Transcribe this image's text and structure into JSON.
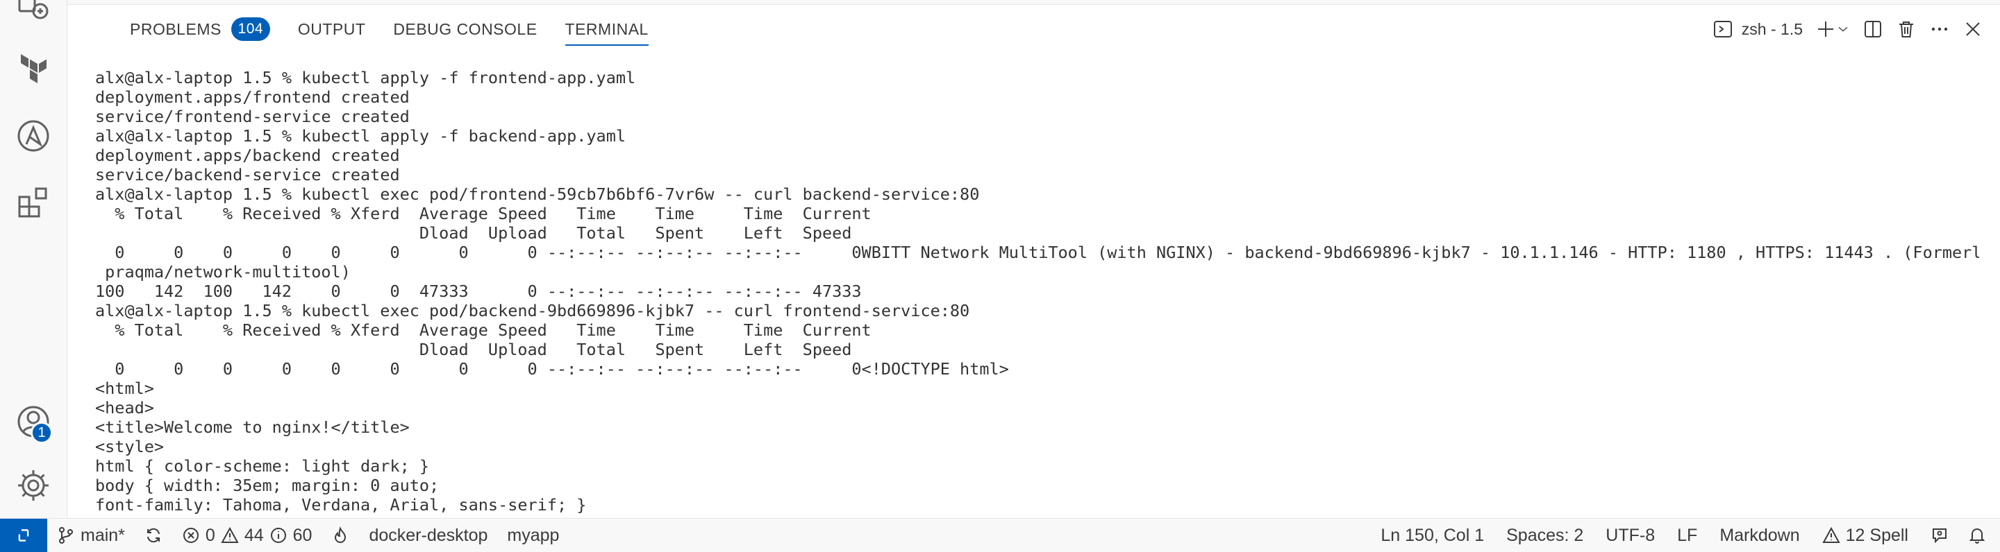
{
  "panel": {
    "tabs": [
      {
        "label": "PROBLEMS",
        "badge": "104"
      },
      {
        "label": "OUTPUT"
      },
      {
        "label": "DEBUG CONSOLE"
      },
      {
        "label": "TERMINAL",
        "active": true
      }
    ],
    "terminal_name": "zsh - 1.5"
  },
  "terminal": {
    "lines": [
      "alx@alx-laptop 1.5 % kubectl apply -f frontend-app.yaml",
      "deployment.apps/frontend created",
      "service/frontend-service created",
      "alx@alx-laptop 1.5 % kubectl apply -f backend-app.yaml",
      "deployment.apps/backend created",
      "service/backend-service created",
      "alx@alx-laptop 1.5 % kubectl exec pod/frontend-59cb7b6bf6-7vr6w -- curl backend-service:80",
      "  % Total    % Received % Xferd  Average Speed   Time    Time     Time  Current",
      "                                 Dload  Upload   Total   Spent    Left  Speed",
      "  0     0    0     0    0     0      0      0 --:--:-- --:--:-- --:--:--     0WBITT Network MultiTool (with NGINX) - backend-9bd669896-kjbk7 - 10.1.1.146 - HTTP: 1180 , HTTPS: 11443 . (Formerly",
      " praqma/network-multitool)",
      "100   142  100   142    0     0  47333      0 --:--:-- --:--:-- --:--:-- 47333",
      "alx@alx-laptop 1.5 % kubectl exec pod/backend-9bd669896-kjbk7 -- curl frontend-service:80",
      "  % Total    % Received % Xferd  Average Speed   Time    Time     Time  Current",
      "                                 Dload  Upload   Total   Spent    Left  Speed",
      "  0     0    0     0    0     0      0      0 --:--:-- --:--:-- --:--:--     0<!DOCTYPE html>",
      "<html>",
      "<head>",
      "<title>Welcome to nginx!</title>",
      "<style>",
      "html { color-scheme: light dark; }",
      "body { width: 35em; margin: 0 auto;",
      "font-family: Tahoma, Verdana, Arial, sans-serif; }"
    ]
  },
  "activity_bar": {
    "account_badge": "1",
    "icons": [
      "remote-explorer-icon",
      "terraform-icon",
      "ansible-icon",
      "extensions-icon",
      "accounts-icon",
      "manage-gear-icon"
    ]
  },
  "statusbar": {
    "branch": "main*",
    "errors": "0",
    "warnings": "44",
    "infos": "60",
    "context": "docker-desktop",
    "namespace": "myapp",
    "position": "Ln 150, Col 1",
    "spaces": "Spaces: 2",
    "encoding": "UTF-8",
    "eol": "LF",
    "language": "Markdown",
    "spell": "12 Spell"
  },
  "colors": {
    "accent": "#005fb8",
    "background": "#ffffff",
    "chrome": "#f8f8f8"
  }
}
